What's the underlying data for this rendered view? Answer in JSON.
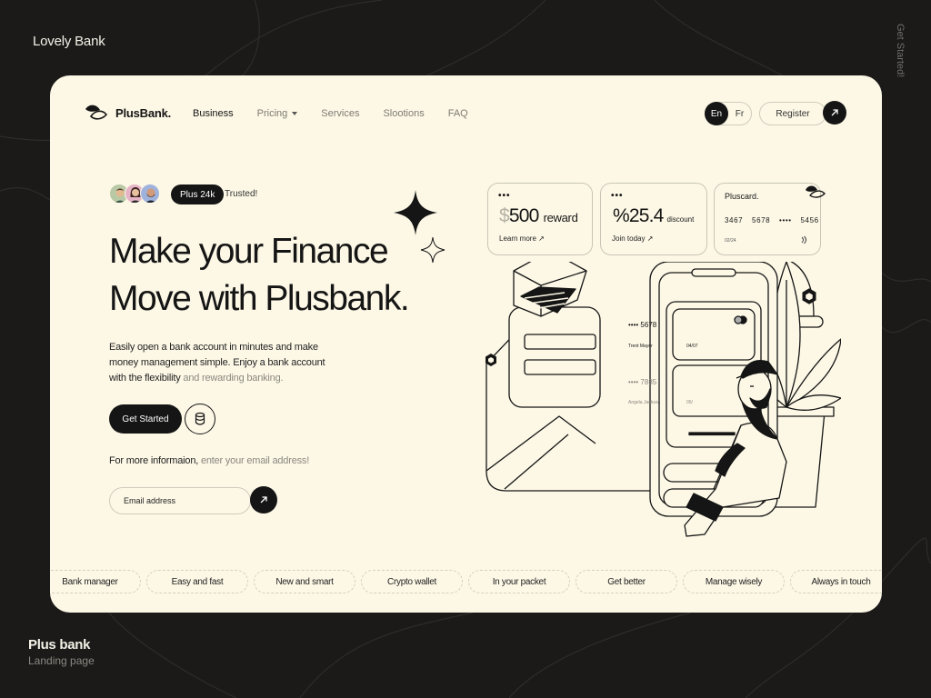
{
  "page": {
    "top_brand": "Lovely Bank",
    "side_text": "Get Started!",
    "footer_title": "Plus bank",
    "footer_sub": "Landing page"
  },
  "nav": {
    "logo": "PlusBank.",
    "items": [
      {
        "label": "Business",
        "active": true
      },
      {
        "label": "Pricing",
        "dropdown": true
      },
      {
        "label": "Services"
      },
      {
        "label": "Slootions"
      },
      {
        "label": "FAQ"
      }
    ],
    "lang_en": "En",
    "lang_fr": "Fr",
    "register": "Register"
  },
  "hero": {
    "badge": "Plus 24k",
    "trusted": "Trusted!",
    "headline_line1": "Make your Finance",
    "headline_line2": "Move with Plusbank.",
    "desc_main": "Easily open a bank account in minutes and make money management simple. Enjoy a bank account with the flexibility",
    "desc_muted": " and rewarding banking.",
    "cta": "Get Started",
    "info_main": "For more informaion,",
    "info_muted": " enter your email address!",
    "email_placeholder": "Email address"
  },
  "cards": {
    "reward": {
      "dots": "•••",
      "currency": "$",
      "amount": "500",
      "label": "reward",
      "link": "Learn more"
    },
    "discount": {
      "dots": "•••",
      "amount": "%25.4",
      "label": "discount",
      "link": "Join today"
    },
    "pluscard": {
      "title": "Pluscard.",
      "number": "3467 5678 •••• 5456",
      "date": "02/24"
    }
  },
  "phone": {
    "card1_num": "•••• 5678",
    "card1_name": "Trent Mayer",
    "card1_exp": "04/07",
    "card2_num": "•••• 7835",
    "card2_name": "Angela Jackson",
    "card2_exp": "05/"
  },
  "ticker": [
    "Bank manager",
    "Easy and fast",
    "New and smart",
    "Crypto wallet",
    "In your packet",
    "Get better",
    "Manage wisely",
    "Always in touch"
  ],
  "colors": {
    "background": "#1b1a19",
    "card": "#fdf8e6",
    "ink": "#151515",
    "muted": "#8a877f"
  }
}
